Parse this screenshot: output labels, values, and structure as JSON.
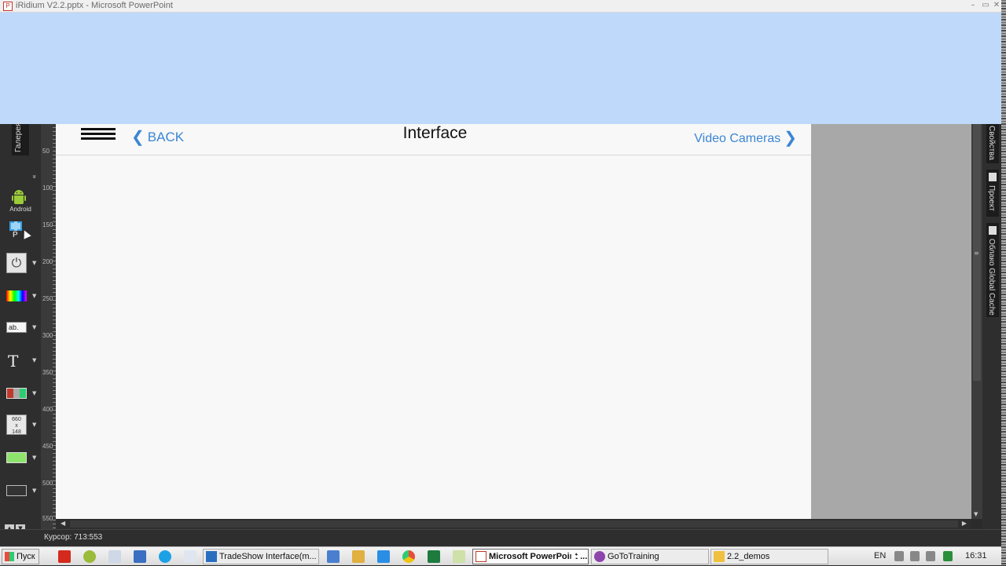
{
  "window": {
    "title": "iRidium V2.2.pptx - Microsoft PowerPoint",
    "controls": [
      "–",
      "▭",
      "✕"
    ]
  },
  "left_toolbar": {
    "gallery_tab": "Галерея",
    "collapse_icon": "»",
    "tools": [
      {
        "name": "android",
        "label": "Android"
      },
      {
        "name": "selection",
        "label": "P"
      },
      {
        "name": "power",
        "label": "⏻"
      },
      {
        "name": "gradient",
        "label": ""
      },
      {
        "name": "text-field",
        "label": "ab."
      },
      {
        "name": "text",
        "label": "T"
      },
      {
        "name": "image",
        "label": ""
      },
      {
        "name": "size",
        "label": "660\nx\n148"
      },
      {
        "name": "color-fill",
        "label": ""
      },
      {
        "name": "dark-fill",
        "label": ""
      }
    ]
  },
  "ruler": {
    "labels": [
      "50",
      "100",
      "150",
      "200",
      "250",
      "300",
      "350",
      "400",
      "450",
      "500",
      "550"
    ]
  },
  "canvas": {
    "nav_bar": {
      "back_label": "BACK",
      "back_chevron": "❮",
      "title": "Interface",
      "next_label": "Video Cameras",
      "next_chevron": "❯"
    }
  },
  "right_panel": {
    "tabs": [
      "Свойства",
      "Проект",
      "Облако Global Cache"
    ]
  },
  "statusbar": {
    "cursor_text": "Курсор: 713:553"
  },
  "taskbar": {
    "start_label": "Пуск",
    "tasks": [
      {
        "label": "TradeShow Interface(m...",
        "active": false
      },
      {
        "label": "Microsoft PowerPoint ...",
        "active": true
      },
      {
        "label": "GoToTraining",
        "active": false
      },
      {
        "label": "2.2_demos",
        "active": false
      }
    ],
    "tray": {
      "language": "EN",
      "clock": "16:31"
    }
  },
  "colors": {
    "accent_blue": "#3b86d4",
    "slide_background": "#bfd9fb",
    "canvas_background": "#f8f8f8"
  }
}
